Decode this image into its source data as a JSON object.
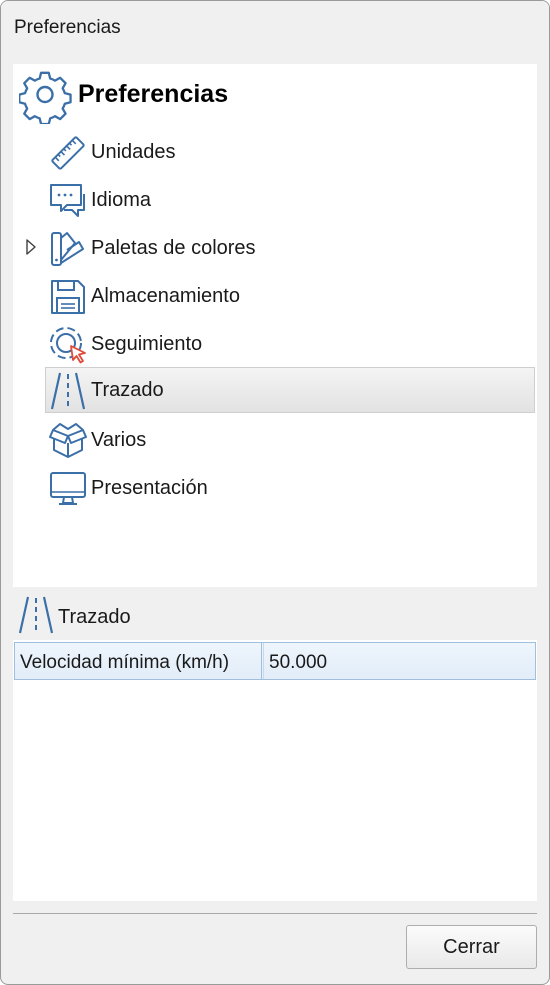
{
  "window": {
    "title": "Preferencias"
  },
  "tree": {
    "root": {
      "label": "Preferencias",
      "icon": "gear-icon"
    },
    "items": [
      {
        "label": "Unidades",
        "icon": "ruler-icon",
        "selected": false,
        "expandable": false
      },
      {
        "label": "Idioma",
        "icon": "speech-bubbles-icon",
        "selected": false,
        "expandable": false
      },
      {
        "label": "Paletas de colores",
        "icon": "color-swatches-icon",
        "selected": false,
        "expandable": true
      },
      {
        "label": "Almacenamiento",
        "icon": "floppy-disk-icon",
        "selected": false,
        "expandable": false
      },
      {
        "label": "Seguimiento",
        "icon": "tracking-cursor-icon",
        "selected": false,
        "expandable": false
      },
      {
        "label": "Trazado",
        "icon": "road-icon",
        "selected": true,
        "expandable": false
      },
      {
        "label": "Varios",
        "icon": "boxes-icon",
        "selected": false,
        "expandable": false
      },
      {
        "label": "Presentación",
        "icon": "monitor-icon",
        "selected": false,
        "expandable": false
      }
    ]
  },
  "detail": {
    "title": "Trazado",
    "icon": "road-icon",
    "properties": [
      {
        "name": "Velocidad mínima (km/h)",
        "value": "50.000"
      }
    ]
  },
  "footer": {
    "close_label": "Cerrar"
  },
  "colors": {
    "icon_blue": "#3b6fa8",
    "accent_red": "#e04a3a",
    "selection_border": "#9fbfdc"
  }
}
